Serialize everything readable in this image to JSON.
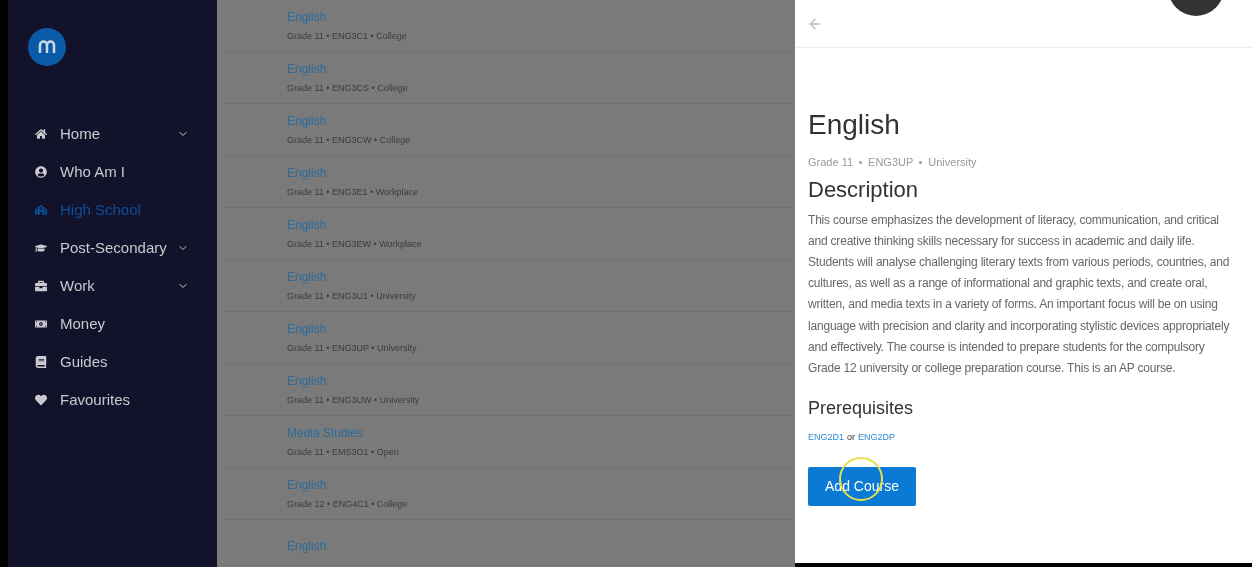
{
  "sidebar": {
    "items": [
      {
        "label": "Home",
        "selected": false,
        "expandable": true
      },
      {
        "label": "Who Am I",
        "selected": false,
        "expandable": false
      },
      {
        "label": "High School",
        "selected": true,
        "expandable": false
      },
      {
        "label": "Post-Secondary",
        "selected": false,
        "expandable": true
      },
      {
        "label": "Work",
        "selected": false,
        "expandable": true
      },
      {
        "label": "Money",
        "selected": false,
        "expandable": false
      },
      {
        "label": "Guides",
        "selected": false,
        "expandable": false
      },
      {
        "label": "Favourites",
        "selected": false,
        "expandable": false
      }
    ]
  },
  "course_list": [
    {
      "title": "English",
      "meta": "Grade 11 • ENG3C1 • College"
    },
    {
      "title": "English",
      "meta": "Grade 11 • ENG3CS • College"
    },
    {
      "title": "English",
      "meta": "Grade 11 • ENG3CW • College"
    },
    {
      "title": "English",
      "meta": "Grade 11 • ENG3E1 • Workplace"
    },
    {
      "title": "English",
      "meta": "Grade 11 • ENG3EW • Workplace"
    },
    {
      "title": "English",
      "meta": "Grade 11 • ENG3U1 • University"
    },
    {
      "title": "English",
      "meta": "Grade 11 • ENG3UP • University"
    },
    {
      "title": "English",
      "meta": "Grade 11 • ENG3UW • University"
    },
    {
      "title": "Media Studies",
      "meta": "Grade 11 • EMS3O1 • Open"
    },
    {
      "title": "English",
      "meta": "Grade 12 • ENG4C1 • College"
    },
    {
      "title": "English"
    }
  ],
  "detail": {
    "title": "English",
    "meta": [
      "Grade 11",
      "ENG3UP",
      "University"
    ],
    "description_heading": "Description",
    "description": "This course emphasizes the development of literacy, communication, and critical and creative thinking skills necessary for success in academic and daily life. Students will analyse challenging literary texts from various periods, countries, and cultures, as well as a range of informational and graphic texts, and create oral, written, and media texts in a variety of forms. An important focus will be on using language with precision and clarity and incorporating stylistic devices appropriately and effectively. The course is intended to prepare students for the compulsory Grade 12 university or college preparation course. This is an AP course.",
    "prerequisites_heading": "Prerequisites",
    "prerequisites": [
      "ENG2D1",
      "ENG2DP"
    ],
    "prerequisites_joiner": "or",
    "button": "Add Course"
  }
}
